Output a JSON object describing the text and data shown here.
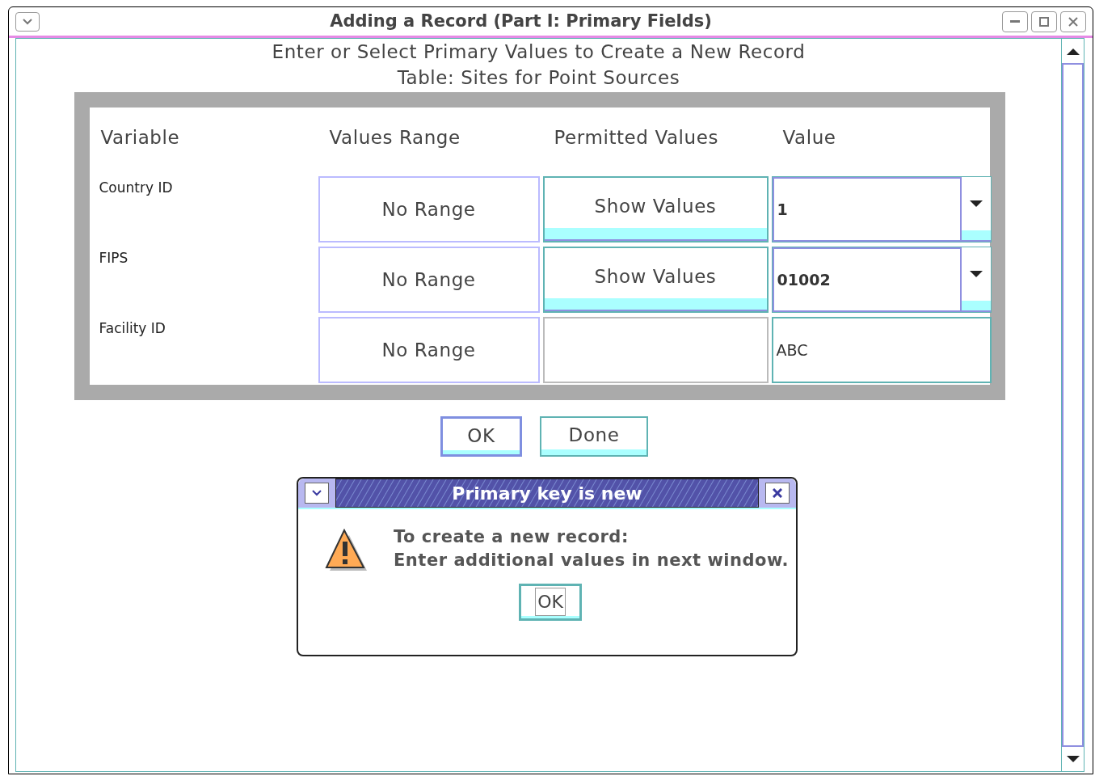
{
  "window": {
    "title": "Adding a Record (Part I: Primary Fields)"
  },
  "heading": [
    "Enter or Select Primary Values to Create a New Record",
    "Table: Sites for Point Sources"
  ],
  "table": {
    "columns": [
      "Variable",
      "Values Range",
      "Permitted Values",
      "Value"
    ],
    "rows": [
      {
        "variable": "Country ID",
        "range": "No Range",
        "permitted": "Show Values",
        "kind": "combo",
        "value": "1"
      },
      {
        "variable": "FIPS",
        "range": "No Range",
        "permitted": "Show Values",
        "kind": "combo",
        "value": "01002"
      },
      {
        "variable": "Facility ID",
        "range": "No Range",
        "kind": "text",
        "value": "ABC"
      }
    ]
  },
  "buttons": [
    "OK",
    "Done"
  ],
  "dialog": {
    "title": "Primary key is new",
    "message": [
      "To create a new record:",
      "Enter additional values in next window."
    ],
    "button": "OK"
  }
}
